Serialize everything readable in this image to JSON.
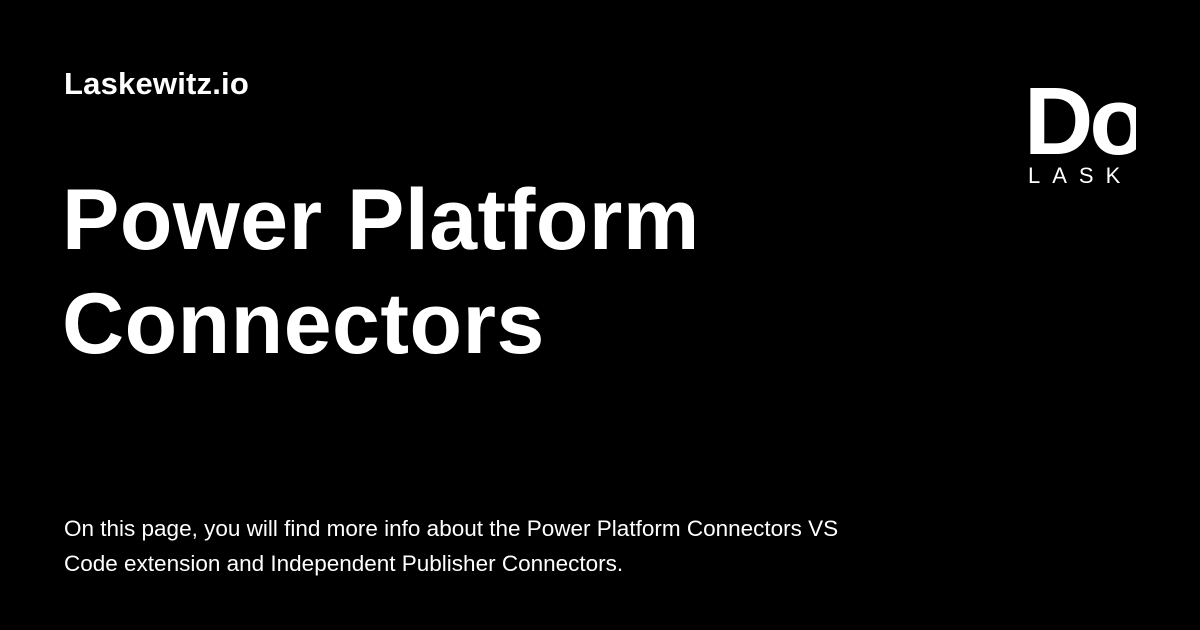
{
  "colors": {
    "background": "#000000",
    "text": "#ffffff"
  },
  "site": {
    "name": "Laskewitz.io"
  },
  "page": {
    "title": "Power Platform Connectors",
    "description": "On this page, you will find more info about the Power Platform Connectors VS Code extension and Independent Publisher Connectors."
  },
  "logo": {
    "icon": "brand-logo",
    "mark_text": "Do",
    "word_text": "LASK"
  }
}
